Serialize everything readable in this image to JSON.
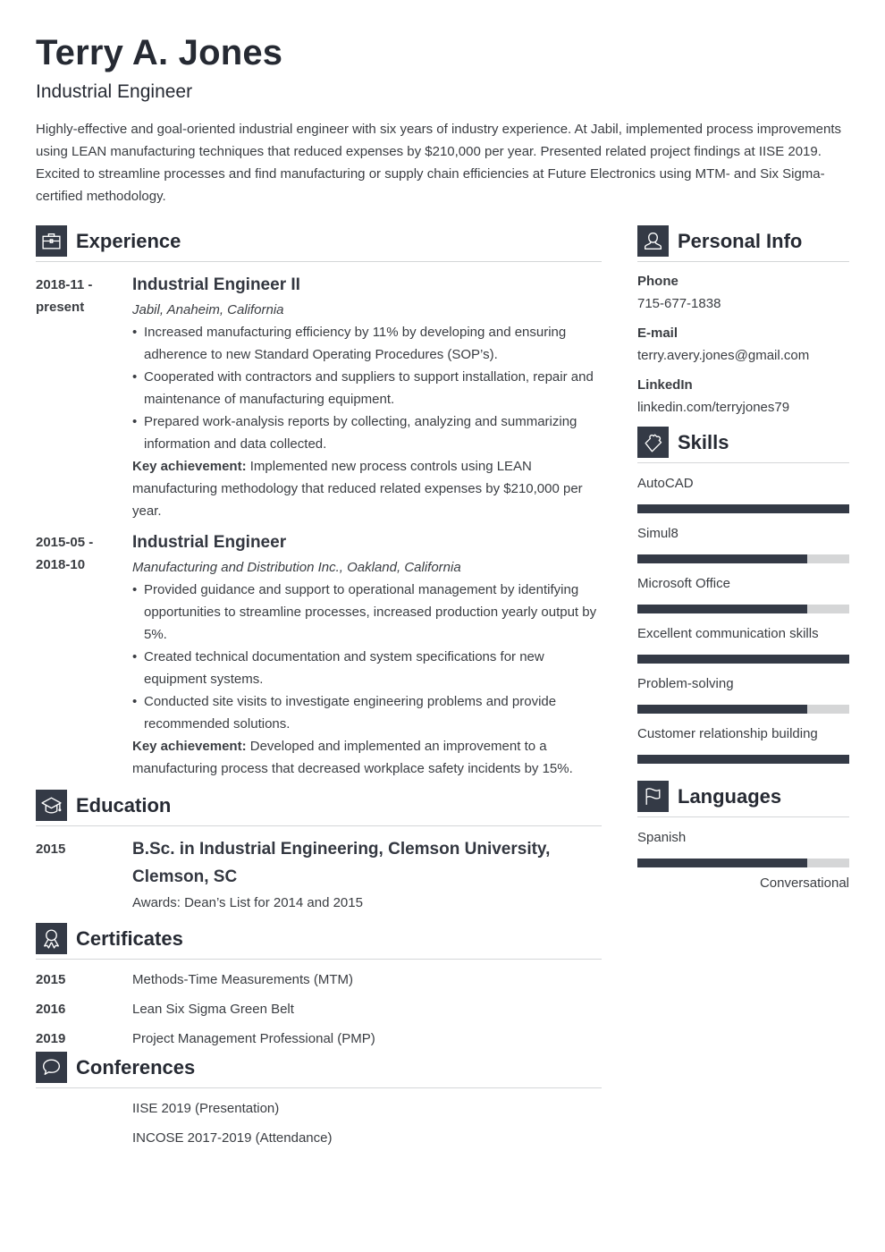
{
  "header": {
    "name": "Terry A. Jones",
    "title": "Industrial Engineer",
    "summary": "Highly-effective and goal-oriented industrial engineer with six years of industry experience. At Jabil, implemented process improvements using LEAN manufacturing techniques that reduced expenses by $210,000 per year. Presented related project findings at IISE 2019. Excited to streamline processes and find manufacturing or supply chain efficiencies at Future Electronics using MTM- and Six Sigma-certified methodology."
  },
  "experience": {
    "heading": "Experience",
    "icon": "briefcase-icon",
    "entries": [
      {
        "date_start": "2018-11 -",
        "date_end": "present",
        "role": "Industrial Engineer II",
        "company": "Jabil, Anaheim, California",
        "bullets": [
          "Increased manufacturing efficiency by 11% by developing and ensuring adherence to new Standard Operating Procedures (SOP’s).",
          "Cooperated with contractors and suppliers to support installation, repair and maintenance of manufacturing equipment.",
          "Prepared work-analysis reports by collecting, analyzing and summarizing information and data collected."
        ],
        "key_label": "Key achievement:",
        "key_text": " Implemented new process controls using LEAN manufacturing methodology that reduced related expenses by $210,000 per year."
      },
      {
        "date_start": "2015-05 -",
        "date_end": "2018-10",
        "role": "Industrial Engineer",
        "company": "Manufacturing and Distribution Inc., Oakland, California",
        "bullets": [
          "Provided guidance and support to operational management by identifying opportunities to streamline processes, increased production yearly output by 5%.",
          "Created technical documentation and system specifications for new equipment systems.",
          "Conducted site visits to investigate engineering problems and provide recommended solutions."
        ],
        "key_label": "Key achievement:",
        "key_text": " Developed and implemented an improvement to a manufacturing process that decreased workplace safety incidents by 15%."
      }
    ]
  },
  "education": {
    "heading": "Education",
    "icon": "graduation-cap-icon",
    "entries": [
      {
        "year": "2015",
        "degree": "B.Sc. in Industrial Engineering, Clemson University, Clemson, SC",
        "awards": "Awards: Dean’s List for 2014 and 2015"
      }
    ]
  },
  "certificates": {
    "heading": "Certificates",
    "icon": "award-ribbon-icon",
    "items": [
      {
        "year": "2015",
        "name": "Methods-Time Measurements (MTM)"
      },
      {
        "year": "2016",
        "name": "Lean Six Sigma Green Belt"
      },
      {
        "year": "2019",
        "name": "Project Management Professional (PMP)"
      }
    ]
  },
  "conferences": {
    "heading": "Conferences",
    "icon": "speech-bubble-icon",
    "items": [
      {
        "name": "IISE 2019 (Presentation)"
      },
      {
        "name": "INCOSE 2017-2019 (Attendance)"
      }
    ]
  },
  "personal_info": {
    "heading": "Personal Info",
    "icon": "user-icon",
    "fields": [
      {
        "label": "Phone",
        "value": "715-677-1838"
      },
      {
        "label": "E-mail",
        "value": "terry.avery.jones@gmail.com"
      },
      {
        "label": "LinkedIn",
        "value": "linkedin.com/terryjones79"
      }
    ]
  },
  "skills": {
    "heading": "Skills",
    "icon": "puzzle-piece-icon",
    "items": [
      {
        "name": "AutoCAD",
        "level": 1.0
      },
      {
        "name": "Simul8",
        "level": 0.8
      },
      {
        "name": "Microsoft Office",
        "level": 0.8
      },
      {
        "name": "Excellent communication skills",
        "level": 1.0
      },
      {
        "name": "Problem-solving",
        "level": 0.8
      },
      {
        "name": "Customer relationship building",
        "level": 1.0
      }
    ]
  },
  "languages": {
    "heading": "Languages",
    "icon": "flag-icon",
    "items": [
      {
        "name": "Spanish",
        "level": 0.8,
        "level_label": "Conversational"
      }
    ]
  },
  "colors": {
    "accent": "#343a46",
    "bar_track": "#d5d6d7",
    "text": "#3a3d42",
    "heading": "#262a33",
    "divider": "#d4d6d8"
  }
}
